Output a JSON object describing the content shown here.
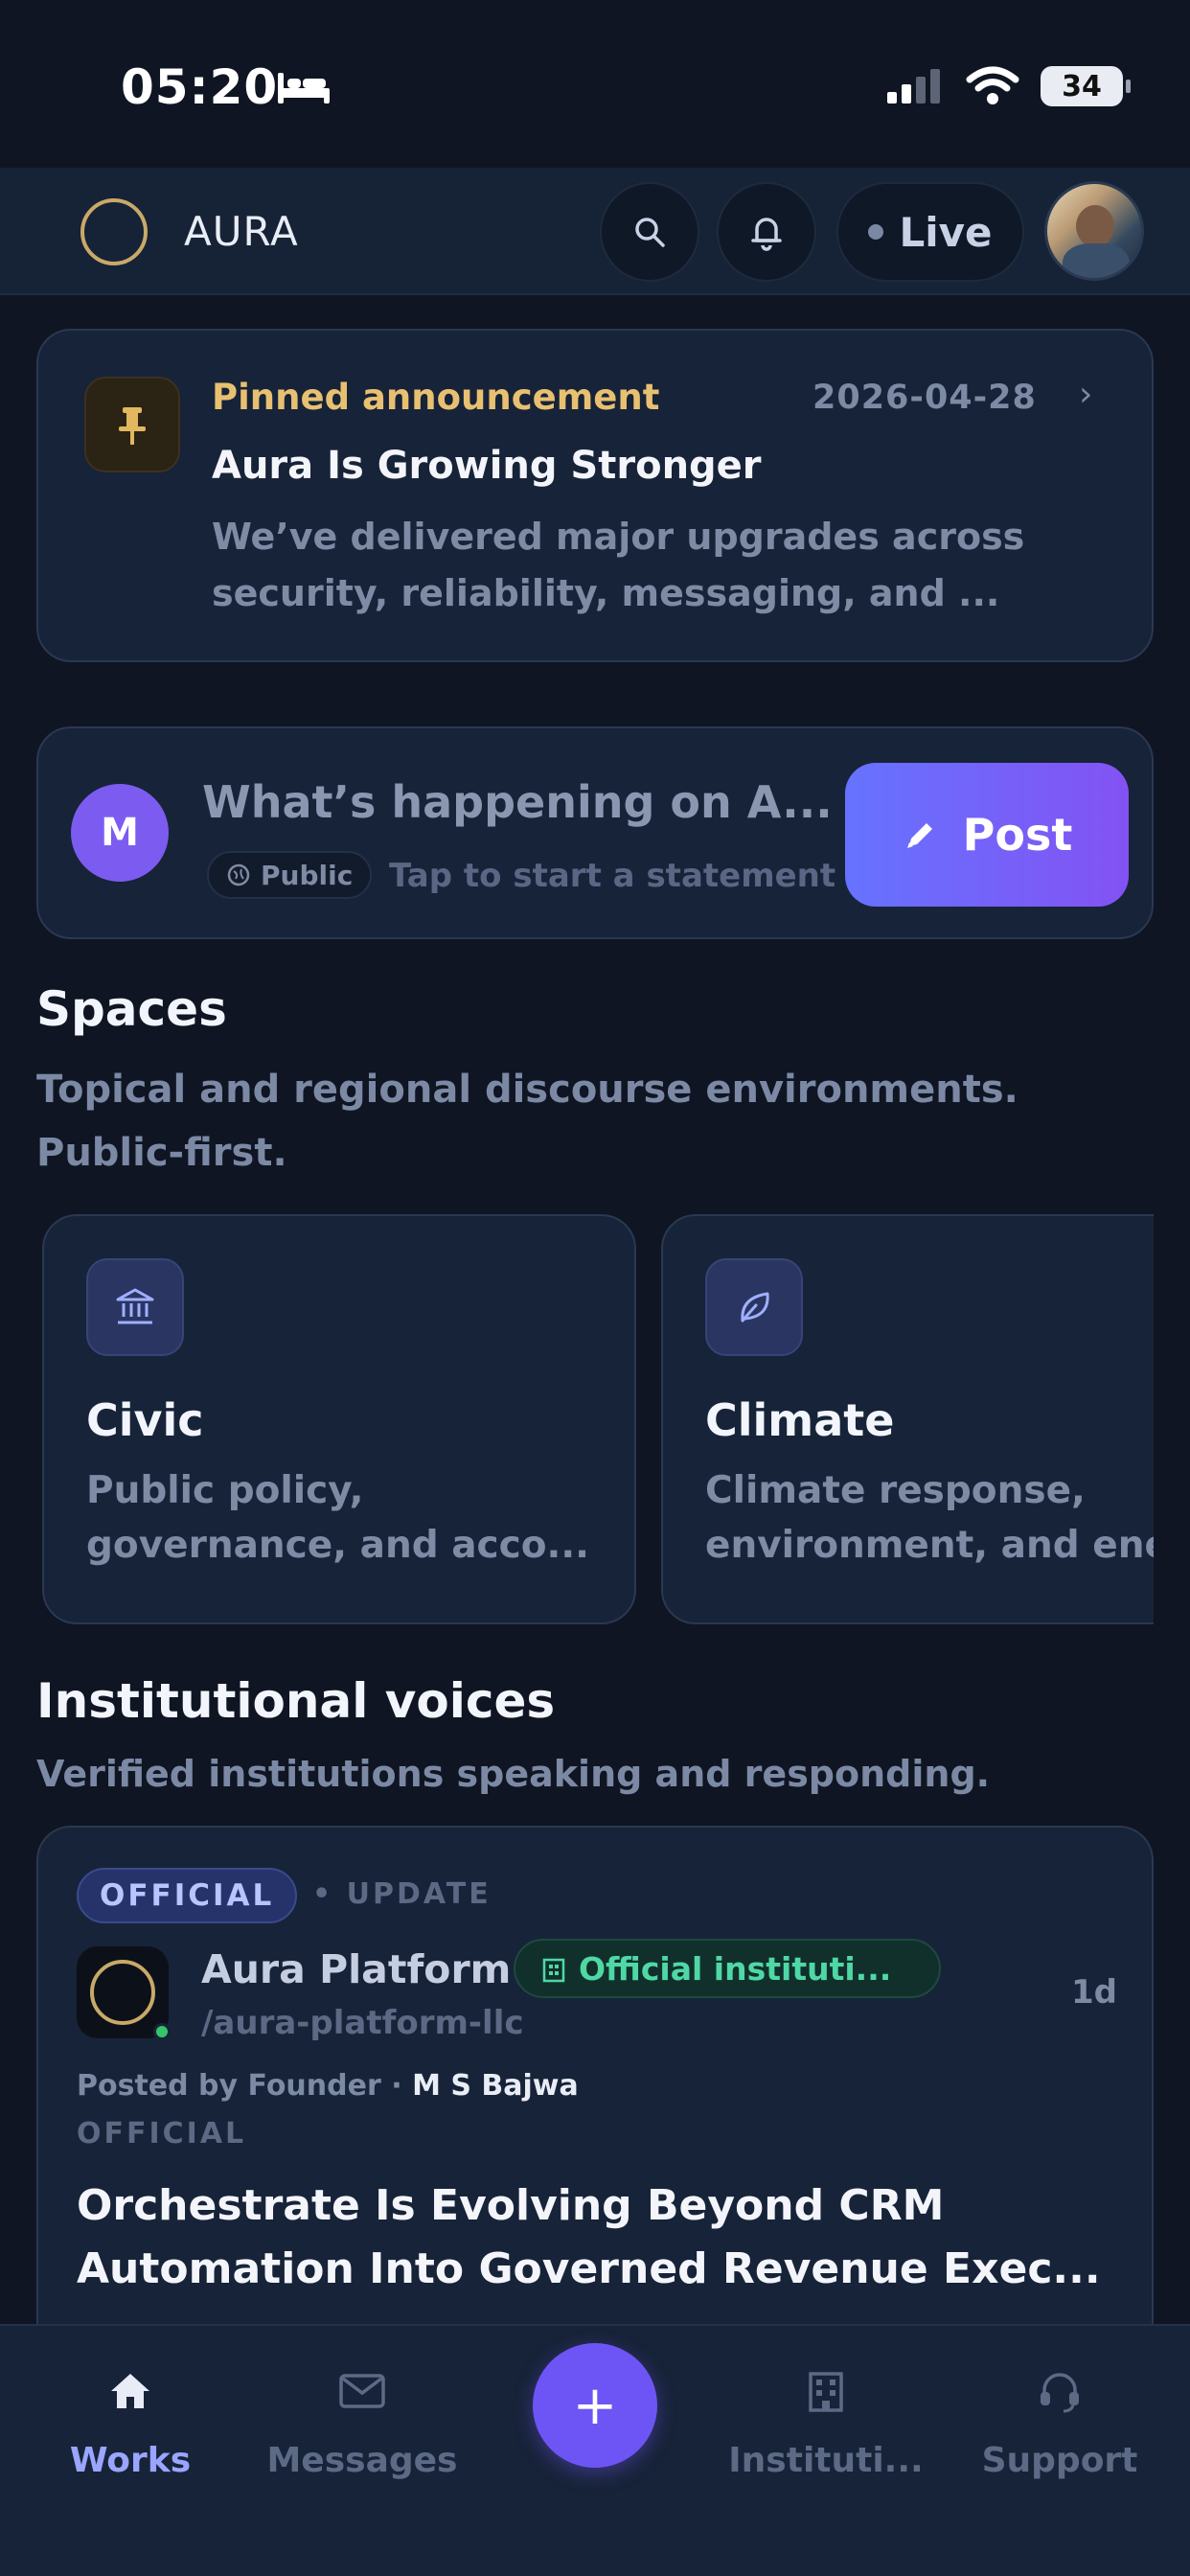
{
  "status_bar": {
    "time": "05:20",
    "battery": "34"
  },
  "header": {
    "app_name": "AURA",
    "live_label": "Live"
  },
  "pinned": {
    "label": "Pinned announcement",
    "date": "2026-04-28",
    "title": "Aura Is Growing Stronger",
    "body": "We’ve delivered major upgrades across security, reliability, messaging, and ..."
  },
  "composer": {
    "avatar_initial": "M",
    "prompt": "What’s happening on A...",
    "visibility": "Public",
    "hint": "Tap to start a statement",
    "post_label": "Post"
  },
  "spaces": {
    "title": "Spaces",
    "subtitle": "Topical and regional discourse environments. Public-first.",
    "items": [
      {
        "name": "Civic",
        "desc_line1": "Public policy,",
        "desc_line2": "governance, and acco...",
        "icon": "bank-icon"
      },
      {
        "name": "Climate",
        "desc_line1": "Climate response,",
        "desc_line2": "environment, and ene",
        "icon": "leaf-icon"
      }
    ]
  },
  "institutional": {
    "title": "Institutional voices",
    "subtitle": "Verified institutions speaking and responding.",
    "post": {
      "tag": "OFFICIAL",
      "kind": "• UPDATE",
      "org_name": "Aura Platform",
      "badge": "Official instituti...",
      "handle": "/aura-platform-llc",
      "age": "1d",
      "posted_by_prefix": "Posted by Founder ·",
      "posted_by_name": "M S Bajwa",
      "category": "OFFICIAL",
      "headline": "Orchestrate Is Evolving Beyond CRM Automation Into Governed Revenue Exec..."
    }
  },
  "bottom_nav": {
    "items": [
      {
        "label": "Works",
        "icon": "home-icon",
        "active": true
      },
      {
        "label": "Messages",
        "icon": "mail-icon",
        "active": false
      },
      {
        "label": "Instituti...",
        "icon": "building-icon",
        "active": false
      },
      {
        "label": "Support",
        "icon": "headset-icon",
        "active": false
      }
    ],
    "fab_label": "+"
  },
  "colors": {
    "background": "#0f1522",
    "card": "#172338",
    "accent": "#6d55f5",
    "pinned_label": "#e8c071",
    "official_green": "#4fd8a6"
  }
}
